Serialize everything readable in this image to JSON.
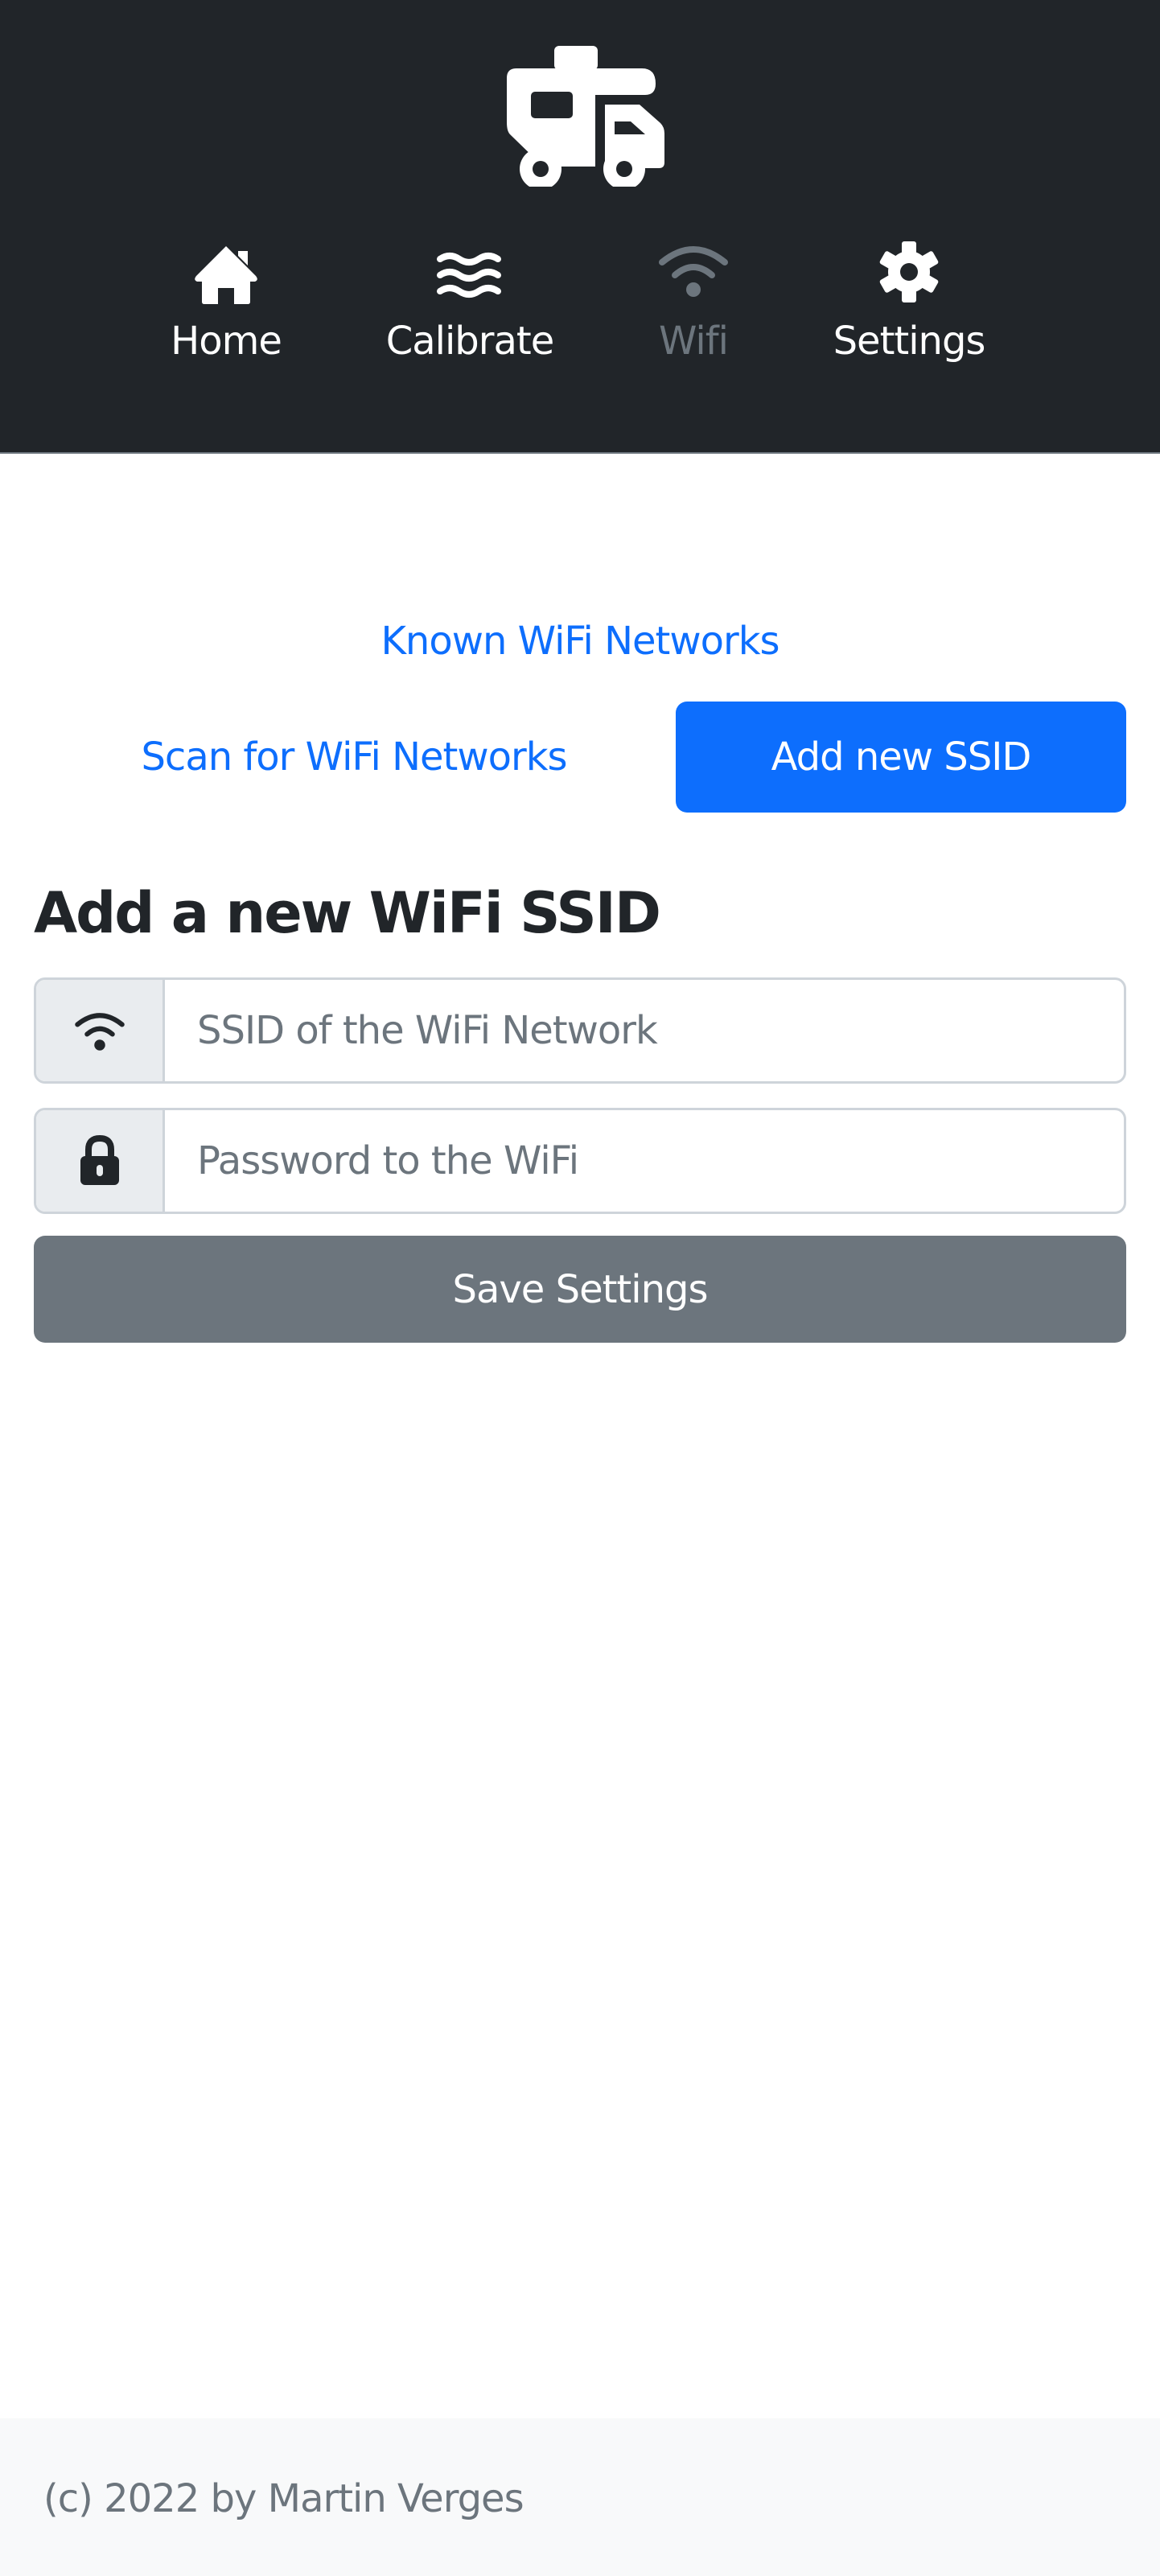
{
  "header": {
    "logo_icon": "caravan-truck-icon",
    "nav": [
      {
        "label": "Home",
        "icon": "house-icon",
        "active": false
      },
      {
        "label": "Calibrate",
        "icon": "water-waves-icon",
        "active": false
      },
      {
        "label": "Wifi",
        "icon": "wifi-icon",
        "active": true
      },
      {
        "label": "Settings",
        "icon": "gear-icon",
        "active": false
      }
    ]
  },
  "main": {
    "known_networks_link": "Known WiFi Networks",
    "scan_networks_link": "Scan for WiFi Networks",
    "add_ssid_button": "Add new SSID",
    "form": {
      "title": "Add a new WiFi SSID",
      "ssid": {
        "icon": "wifi-icon",
        "value": "",
        "placeholder": "SSID of the WiFi Network"
      },
      "password": {
        "icon": "lock-icon",
        "value": "",
        "placeholder": "Password to the WiFi"
      },
      "save_button": "Save Settings"
    }
  },
  "footer": {
    "text": "(c) 2022 by Martin Verges"
  },
  "colors": {
    "header_bg": "#212529",
    "primary": "#0d6efd",
    "secondary": "#6c757d",
    "footer_bg": "#f8f9fa",
    "addon_bg": "#e9ecef",
    "border": "#ced4da"
  }
}
